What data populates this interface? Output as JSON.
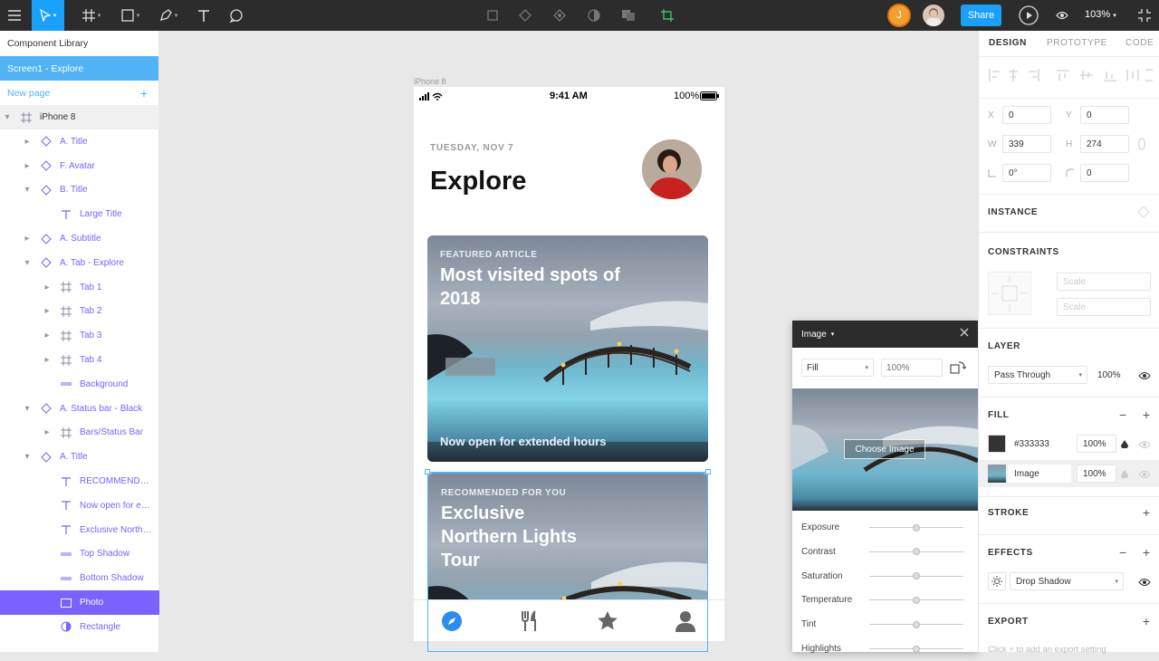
{
  "toolbar": {
    "share_label": "Share",
    "zoom": "103%",
    "user_initial": "J",
    "accent": "#18a0fb"
  },
  "left_panel": {
    "library": "Component Library",
    "page": "Screen1 - Explore",
    "new_page": "New page",
    "layers": [
      {
        "label": "iPhone 8",
        "icon": "frame-icon",
        "indent": 0,
        "chev": "down"
      },
      {
        "label": "A. Title",
        "icon": "component-icon",
        "indent": 1,
        "chev": "right"
      },
      {
        "label": "F. Avatar",
        "icon": "component-icon",
        "indent": 1,
        "chev": "right"
      },
      {
        "label": "B. Title",
        "icon": "component-icon",
        "indent": 1,
        "chev": "down"
      },
      {
        "label": "Large Title",
        "icon": "text-icon",
        "indent": 2,
        "chev": "none"
      },
      {
        "label": "A. Subtitle",
        "icon": "component-icon",
        "indent": 1,
        "chev": "right"
      },
      {
        "label": "A. Tab - Explore",
        "icon": "component-icon",
        "indent": 1,
        "chev": "down"
      },
      {
        "label": "Tab 1",
        "icon": "frame-icon",
        "indent": 2,
        "chev": "right"
      },
      {
        "label": "Tab 2",
        "icon": "frame-icon",
        "indent": 2,
        "chev": "right"
      },
      {
        "label": "Tab 3",
        "icon": "frame-icon",
        "indent": 2,
        "chev": "right"
      },
      {
        "label": "Tab 4",
        "icon": "frame-icon",
        "indent": 2,
        "chev": "right"
      },
      {
        "label": "Background",
        "icon": "rectangle-line-icon",
        "indent": 2,
        "chev": "none"
      },
      {
        "label": "A. Status bar - Black",
        "icon": "component-icon",
        "indent": 1,
        "chev": "down"
      },
      {
        "label": "Bars/Status Bar",
        "icon": "frame-icon",
        "indent": 2,
        "chev": "right"
      },
      {
        "label": "A. Title",
        "icon": "component-icon",
        "indent": 1,
        "chev": "down"
      },
      {
        "label": "RECOMMENDED ...",
        "icon": "text-icon",
        "indent": 2,
        "chev": "none"
      },
      {
        "label": "Now open for ext...",
        "icon": "text-icon",
        "indent": 2,
        "chev": "none"
      },
      {
        "label": "Exclusive Northe...",
        "icon": "text-icon",
        "indent": 2,
        "chev": "none"
      },
      {
        "label": "Top Shadow",
        "icon": "rectangle-line-icon",
        "indent": 2,
        "chev": "none"
      },
      {
        "label": "Bottom Shadow",
        "icon": "rectangle-line-icon",
        "indent": 2,
        "chev": "none"
      },
      {
        "label": "Photo",
        "icon": "rectangle-icon",
        "indent": 2,
        "chev": "none",
        "selected": true
      },
      {
        "label": "Rectangle",
        "icon": "ellipse-icon",
        "indent": 2,
        "chev": "none"
      }
    ]
  },
  "canvas": {
    "frame_label": "iPhone 8",
    "status": {
      "time": "9:41 AM",
      "battery": "100%"
    },
    "date": "TUESDAY, NOV 7",
    "title": "Explore",
    "card1": {
      "kicker": "FEATURED ARTICLE",
      "title": "Most visited spots of 2018",
      "subtitle": "Now open for extended hours"
    },
    "card2": {
      "kicker": "RECOMMENDED FOR YOU",
      "title": "Exclusive Northern Lights Tour"
    },
    "tabs": [
      "compass-icon",
      "fork-knife-icon",
      "star-icon",
      "person-icon"
    ]
  },
  "image_panel": {
    "title": "Image",
    "mode": "Fill",
    "opacity_placeholder": "100%",
    "choose_label": "Choose Image",
    "adjustments": [
      "Exposure",
      "Contrast",
      "Saturation",
      "Temperature",
      "Tint",
      "Highlights"
    ]
  },
  "right_panel": {
    "tabs": [
      "DESIGN",
      "PROTOTYPE",
      "CODE"
    ],
    "x": "0",
    "y": "0",
    "w": "339",
    "h": "274",
    "rotation": "0°",
    "radius": "0",
    "labels": {
      "x": "X",
      "y": "Y",
      "w": "W",
      "h": "H"
    },
    "instance": "INSTANCE",
    "constraints": "CONSTRAINTS",
    "constraint_h": "Scale",
    "constraint_v": "Scale",
    "layer": "LAYER",
    "blend": "Pass Through",
    "layer_opacity": "100%",
    "fill": "FILL",
    "fill_color": "#333333",
    "fill_opacity": "100%",
    "fill_image": "Image",
    "fill_image_opacity": "100%",
    "stroke": "STROKE",
    "effects": "EFFECTS",
    "effect": "Drop Shadow",
    "export": "EXPORT",
    "export_hint": "Click + to add an export setting"
  }
}
